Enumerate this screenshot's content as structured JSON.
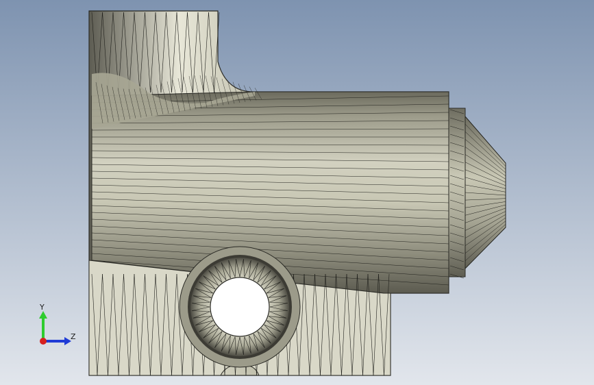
{
  "viewport": {
    "background_top": "#7e93b0",
    "background_bottom": "#e2e6ec",
    "model_fill": "#bdbca8",
    "model_highlight": "#ecebdc",
    "model_shadow": "#5f5e52",
    "mesh_line_color": "#1e1e1a"
  },
  "triad": {
    "y_label": "Y",
    "z_label": "Z",
    "y_color": "#2ecc2e",
    "z_color": "#1f3bd6",
    "x_color": "#d62020"
  }
}
